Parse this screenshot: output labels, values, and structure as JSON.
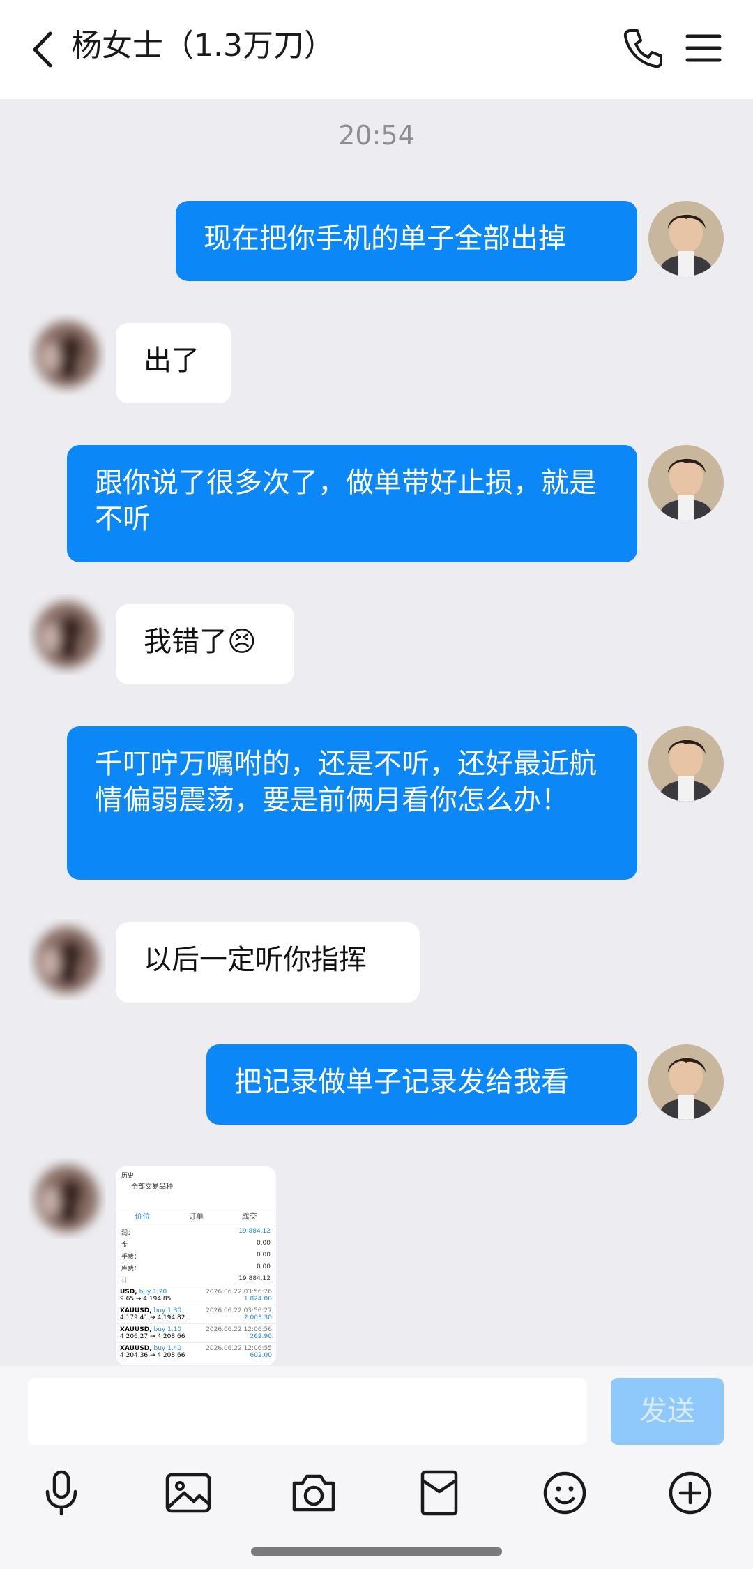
{
  "header": {
    "title": "杨女士（1.3万刀）",
    "back_icon": "chevron-left-icon",
    "phone_icon": "phone-icon",
    "menu_icon": "hamburger-menu-icon"
  },
  "chat": {
    "time": "20:54",
    "messages": [
      {
        "from": "me",
        "text": "现在把你手机的单子全部出掉"
      },
      {
        "from": "them",
        "text": "出了"
      },
      {
        "from": "me",
        "text": "跟你说了很多次了，做单带好止损，就是不听"
      },
      {
        "from": "them",
        "text": "我错了😣"
      },
      {
        "from": "me",
        "text": "千叮咛万嘱咐的，还是不听，还好最近航情偏弱震荡，要是前俩月看你怎么办！"
      },
      {
        "from": "them",
        "text": "以后一定听你指挥"
      },
      {
        "from": "me",
        "text": "把记录做单子记录发给我看"
      },
      {
        "from": "them",
        "type": "image"
      }
    ]
  },
  "screenshot_image": {
    "header_title": "历史",
    "header_subtitle": "全部交易品种",
    "tabs": [
      "价位",
      "订单",
      "成交"
    ],
    "summary": [
      {
        "label": "润：",
        "value": "19 884.12"
      },
      {
        "label": "金",
        "value": "0.00"
      },
      {
        "label": "手费：",
        "value": "0.00"
      },
      {
        "label": "库费：",
        "value": "0.00"
      },
      {
        "label": "计",
        "value": "19 884.12"
      }
    ],
    "trades": [
      {
        "symbol": "USD,",
        "action": "buy 1.20",
        "date": "2026.06.22 03:56:26",
        "prices": "9.65 → 4 194.85",
        "profit": "1 824.00"
      },
      {
        "symbol": "XAUUSD,",
        "action": "buy 1.30",
        "date": "2026.06.22 03:56:27",
        "prices": "4 179.41 → 4 194.82",
        "profit": "2 003.30"
      },
      {
        "symbol": "XAUUSD,",
        "action": "buy 1.10",
        "date": "2026.06.22 12:06:56",
        "prices": "4 206.27 → 4 208.66",
        "profit": "262.90"
      },
      {
        "symbol": "XAUUSD,",
        "action": "buy 1.40",
        "date": "2026.06.22 12:06:55",
        "prices": "4 204.36 → 4 208.66",
        "profit": "602.00"
      }
    ]
  },
  "input": {
    "value": "",
    "send_label": "发送"
  },
  "toolbar": {
    "icons": [
      "microphone-icon",
      "image-icon",
      "camera-icon",
      "red-packet-icon",
      "emoji-icon",
      "plus-icon"
    ]
  },
  "colors": {
    "my_bubble": "#0B87F8",
    "background": "#EDEDF1",
    "send_disabled": "#8FC8FB"
  }
}
